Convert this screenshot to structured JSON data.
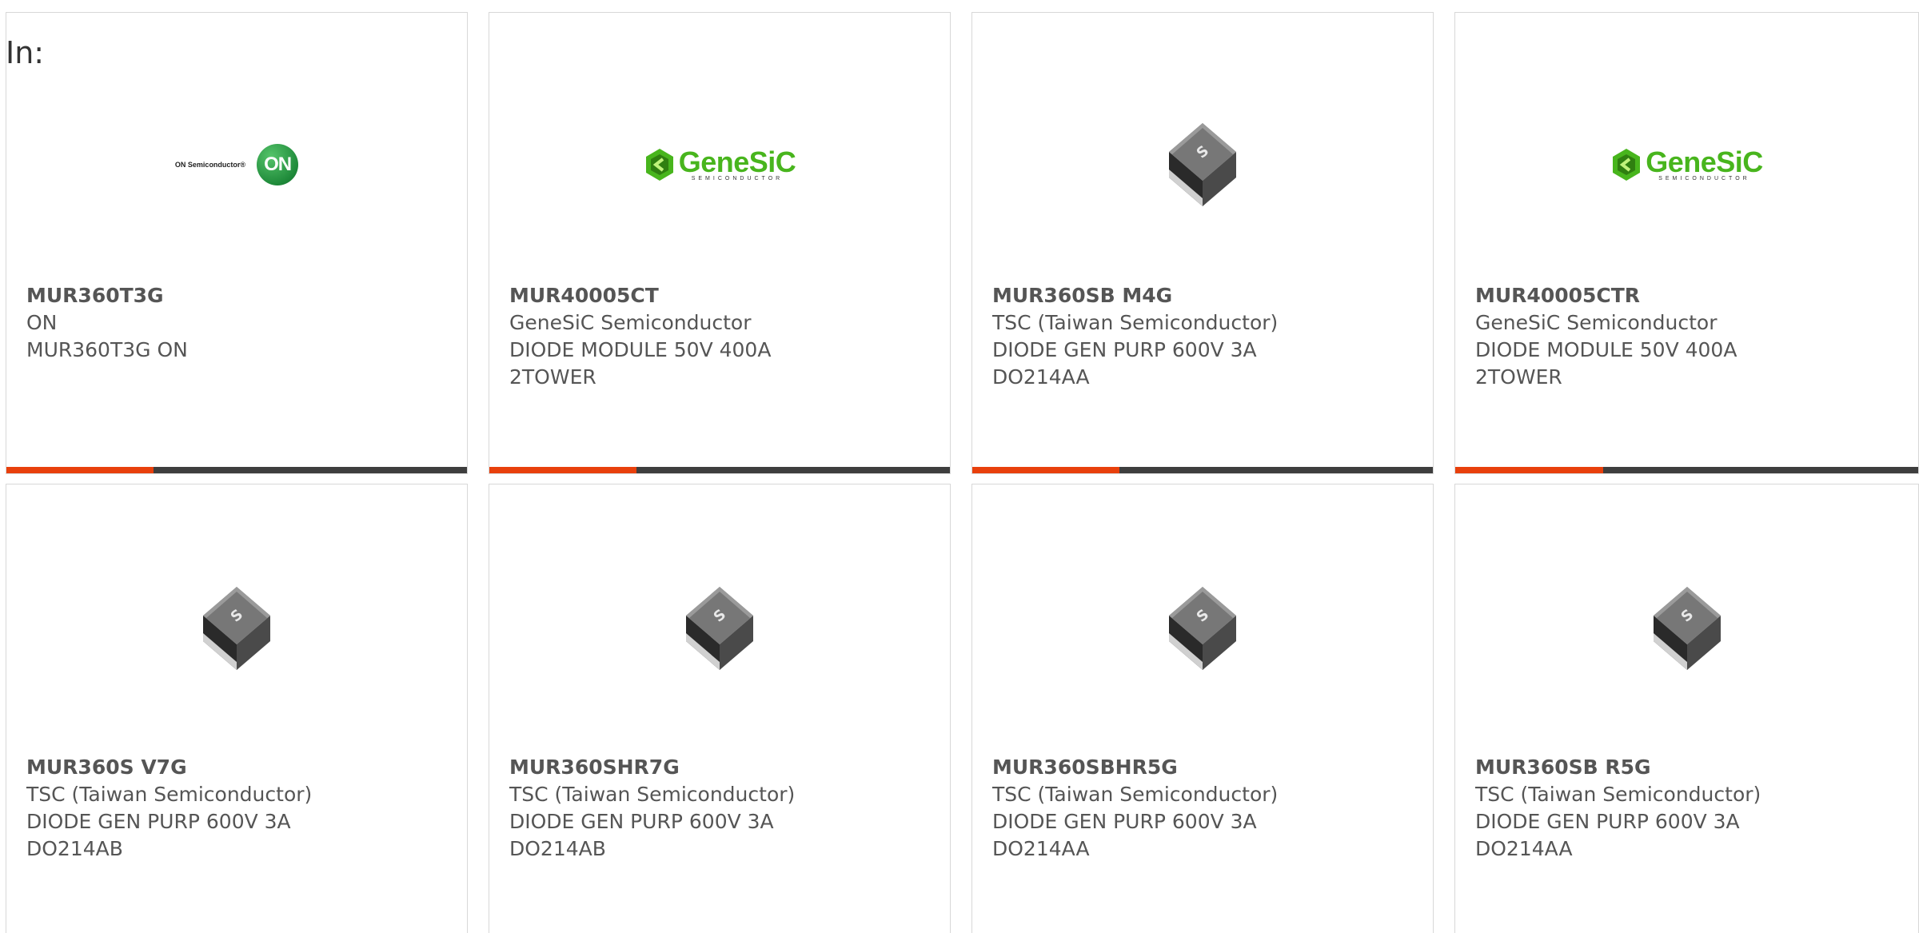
{
  "header": {
    "in_label": "In:"
  },
  "colors": {
    "accent": "#e8400c",
    "bar": "#3e3e3e",
    "genesic_green": "#48b51d",
    "on_green": "#1f8a3a"
  },
  "products": [
    {
      "part_number": "MUR360T3G",
      "manufacturer": "ON",
      "description": "MUR360T3G ON",
      "description2": "",
      "image": "on-semiconductor-logo",
      "logo_text": "ON Semiconductor®",
      "logo_mark": "ON",
      "progress": 0.32
    },
    {
      "part_number": "MUR40005CT",
      "manufacturer": "GeneSiC Semiconductor",
      "description": "DIODE MODULE 50V 400A",
      "description2": "2TOWER",
      "image": "genesic-logo",
      "logo_text": "GeneSiC",
      "logo_sub": "SEMICONDUCTOR",
      "progress": 0.32
    },
    {
      "part_number": "MUR360SB M4G",
      "manufacturer": "TSC (Taiwan Semiconductor)",
      "description": "DIODE GEN PURP 600V 3A",
      "description2": "DO214AA",
      "image": "smd-diode-chip",
      "progress": 0.32
    },
    {
      "part_number": "MUR40005CTR",
      "manufacturer": "GeneSiC Semiconductor",
      "description": "DIODE MODULE 50V 400A",
      "description2": "2TOWER",
      "image": "genesic-logo",
      "logo_text": "GeneSiC",
      "logo_sub": "SEMICONDUCTOR",
      "progress": 0.32
    },
    {
      "part_number": "MUR360S V7G",
      "manufacturer": "TSC (Taiwan Semiconductor)",
      "description": "DIODE GEN PURP 600V 3A",
      "description2": "DO214AB",
      "image": "smd-diode-chip"
    },
    {
      "part_number": "MUR360SHR7G",
      "manufacturer": "TSC (Taiwan Semiconductor)",
      "description": "DIODE GEN PURP 600V 3A",
      "description2": "DO214AB",
      "image": "smd-diode-chip"
    },
    {
      "part_number": "MUR360SBHR5G",
      "manufacturer": "TSC (Taiwan Semiconductor)",
      "description": "DIODE GEN PURP 600V 3A",
      "description2": "DO214AA",
      "image": "smd-diode-chip"
    },
    {
      "part_number": "MUR360SB R5G",
      "manufacturer": "TSC (Taiwan Semiconductor)",
      "description": "DIODE GEN PURP 600V 3A",
      "description2": "DO214AA",
      "image": "smd-diode-chip"
    }
  ]
}
